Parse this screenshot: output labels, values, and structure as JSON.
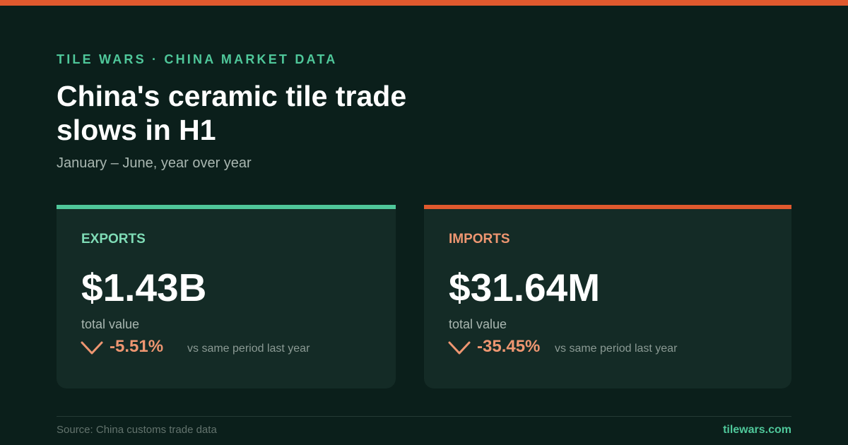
{
  "header": {
    "kicker": "TILE WARS · CHINA MARKET DATA",
    "title": "China's ceramic tile trade slows in H1",
    "subtitle": "January – June, year over year"
  },
  "cards": [
    {
      "label": "EXPORTS",
      "value": "$1.43B",
      "caption": "total value",
      "change": "-5.51%",
      "comparison": "vs same period last year",
      "accent_color": "#4fc79a",
      "icon": "chevron-down-icon"
    },
    {
      "label": "IMPORTS",
      "value": "$31.64M",
      "caption": "total value",
      "change": "-35.45%",
      "comparison": "vs same period last year",
      "accent_color": "#e0592e",
      "icon": "chevron-down-icon"
    }
  ],
  "footer": {
    "source": "Source: China customs trade data",
    "brand": "tilewars.com"
  },
  "colors": {
    "background": "#0b1f1b",
    "card": "#142b26",
    "positive_accent": "#4fc79a",
    "negative_accent": "#e0592e",
    "decline": "#ee9671"
  }
}
